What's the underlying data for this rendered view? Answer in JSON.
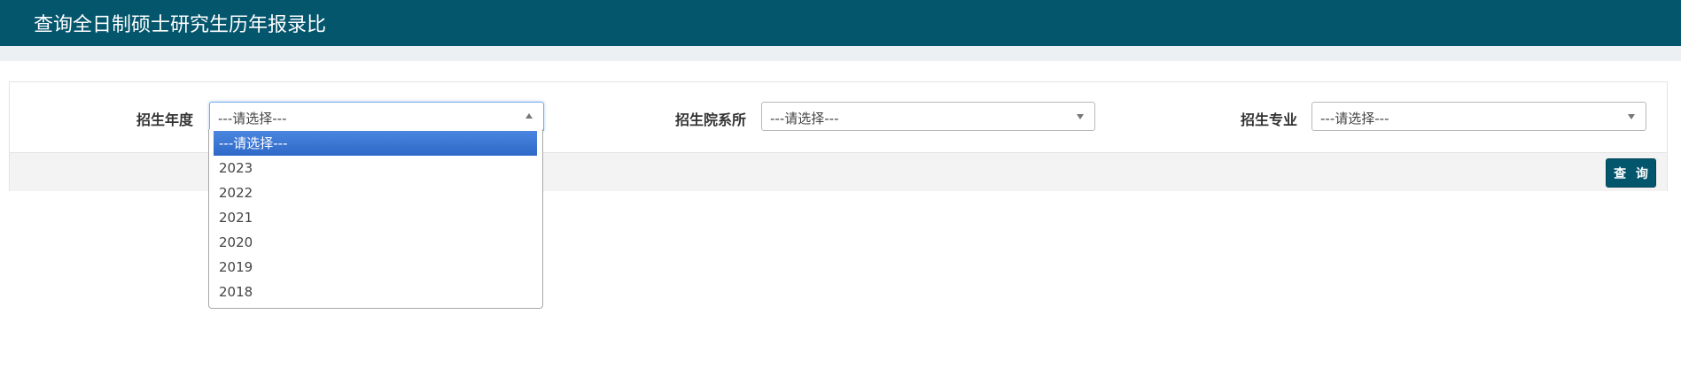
{
  "header": {
    "title": "查询全日制硕士研究生历年报录比"
  },
  "filters": {
    "year": {
      "label": "招生年度",
      "value": "---请选择---",
      "options": [
        "---请选择---",
        "2023",
        "2022",
        "2021",
        "2020",
        "2019",
        "2018"
      ]
    },
    "department": {
      "label": "招生院系所",
      "value": "---请选择---"
    },
    "major": {
      "label": "招生专业",
      "value": "---请选择---"
    }
  },
  "actions": {
    "query_label": "查 询"
  },
  "colors": {
    "header_bg": "#04566d",
    "selected_option": "#3b76d3",
    "button_bg": "#04566d"
  },
  "icons": {
    "select_caret": "caret-icon"
  }
}
